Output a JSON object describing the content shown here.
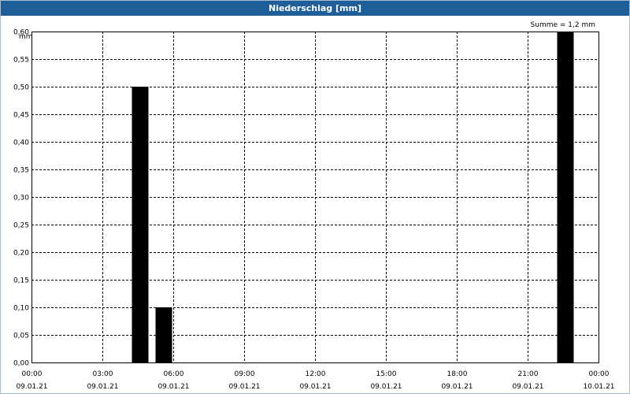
{
  "window": {
    "title": "Niederschlag [mm]"
  },
  "summary": "Summe = 1,2 mm",
  "colors": {
    "title_bar": "#1f5f99",
    "bars": "#000000",
    "grid": "#000000"
  },
  "chart_data": {
    "type": "bar",
    "title": "Niederschlag [mm]",
    "ylabel": "mm",
    "ylim": [
      0,
      0.6
    ],
    "yticks": [
      "0,00",
      "0,05",
      "0,10",
      "0,15",
      "0,20",
      "0,25",
      "0,30",
      "0,35",
      "0,40",
      "0,45",
      "0,50",
      "0,55",
      "0,60"
    ],
    "xlim_hours": [
      0,
      24
    ],
    "xticks": [
      {
        "time": "00:00",
        "date": "09.01.21"
      },
      {
        "time": "03:00",
        "date": "09.01.21"
      },
      {
        "time": "06:00",
        "date": "09.01.21"
      },
      {
        "time": "09:00",
        "date": "09.01.21"
      },
      {
        "time": "12:00",
        "date": "09.01.21"
      },
      {
        "time": "15:00",
        "date": "09.01.21"
      },
      {
        "time": "18:00",
        "date": "09.01.21"
      },
      {
        "time": "21:00",
        "date": "09.01.21"
      },
      {
        "time": "00:00",
        "date": "10.01.21"
      }
    ],
    "grid": true,
    "bars": [
      {
        "x": "04:00",
        "value": 0.5
      },
      {
        "x": "05:00",
        "value": 0.1
      },
      {
        "x": "22:00",
        "value": 0.6
      }
    ]
  }
}
